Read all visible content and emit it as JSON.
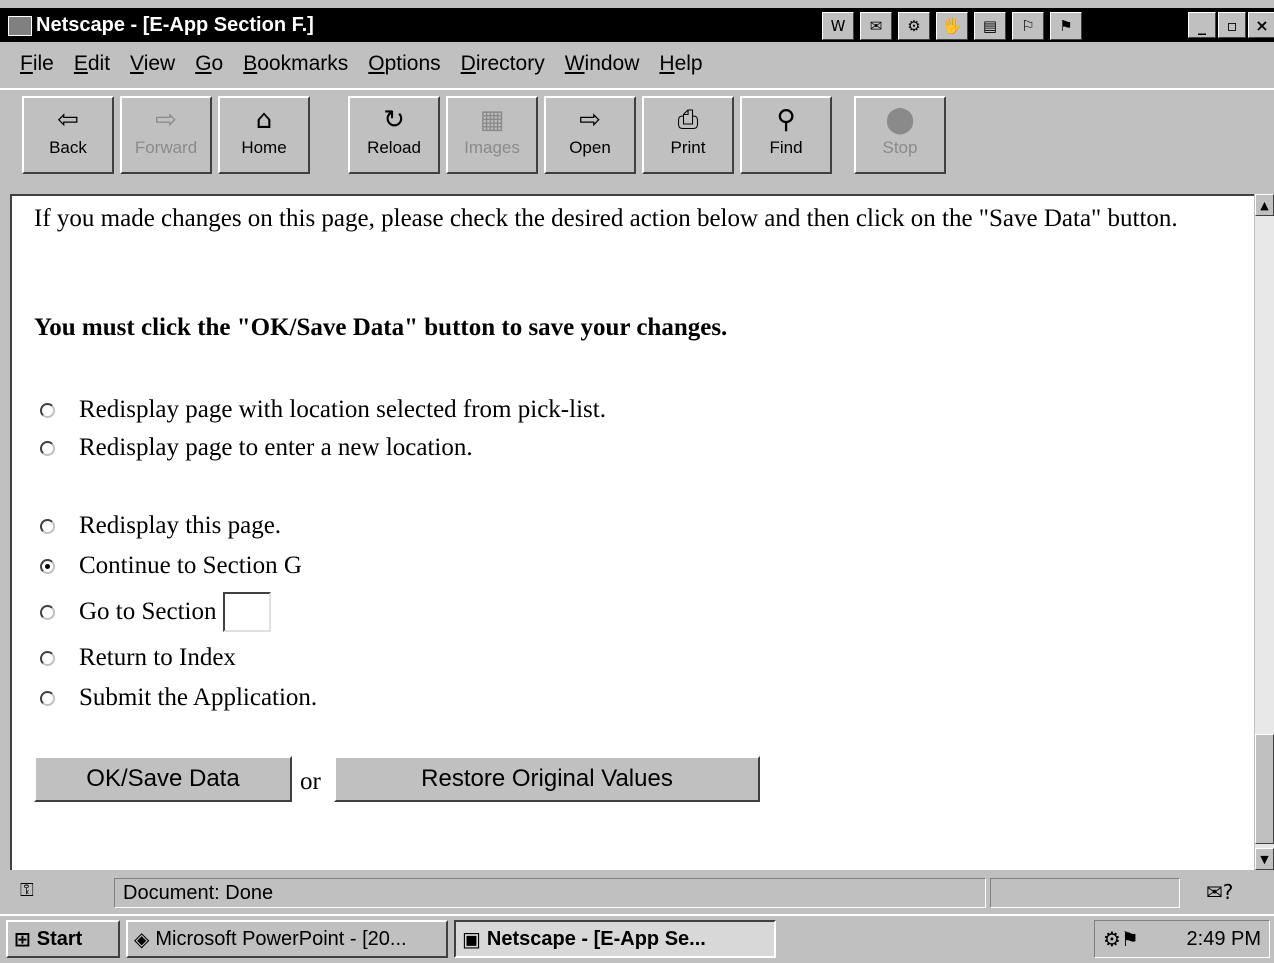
{
  "window": {
    "title": "Netscape - [E-App Section F.]",
    "app_icon": "netscape-icon",
    "title_icons": [
      "W",
      "✉",
      "⚙",
      "🖐",
      "▤",
      "⚐",
      "⚑"
    ],
    "minimize": "_",
    "maximize": "▫",
    "close": "×"
  },
  "menu": {
    "items": [
      {
        "mnemonic": "F",
        "rest": "ile"
      },
      {
        "mnemonic": "E",
        "rest": "dit"
      },
      {
        "mnemonic": "V",
        "rest": "iew"
      },
      {
        "mnemonic": "G",
        "rest": "o"
      },
      {
        "mnemonic": "B",
        "rest": "ookmarks"
      },
      {
        "mnemonic": "O",
        "rest": "ptions"
      },
      {
        "mnemonic": "D",
        "rest": "irectory"
      },
      {
        "mnemonic": "W",
        "rest": "indow"
      },
      {
        "mnemonic": "H",
        "rest": "elp"
      }
    ]
  },
  "toolbar": {
    "back": {
      "label": "Back",
      "icon": "⇦"
    },
    "forward": {
      "label": "Forward",
      "icon": "⇨"
    },
    "home": {
      "label": "Home",
      "icon": "⌂"
    },
    "reload": {
      "label": "Reload",
      "icon": "↻"
    },
    "images": {
      "label": "Images",
      "icon": "▦"
    },
    "open": {
      "label": "Open",
      "icon": "⇨"
    },
    "print": {
      "label": "Print",
      "icon": "⎙"
    },
    "find": {
      "label": "Find",
      "icon": "⚲"
    },
    "stop": {
      "label": "Stop",
      "icon": "⬤"
    }
  },
  "content": {
    "intro": "If you made changes on this page, please check the desired action below and then click on the \"Save Data\" button.",
    "must_click": "You must click the \"OK/Save Data\" button to save your changes.",
    "options": {
      "pick_list": "Redisplay page with location selected from pick-list.",
      "new_location": "Redisplay page to enter a new location.",
      "redisplay": "Redisplay this page.",
      "continue_g": "Continue to Section G",
      "goto_section": "Go to Section",
      "return_index": "Return to Index",
      "submit_app": "Submit the Application."
    },
    "selected_option": "continue_g",
    "goto_section_value": "",
    "ok_save_button": "OK/Save Data",
    "or_text": "or",
    "restore_button": "Restore Original Values"
  },
  "scrollbar": {
    "up": "▲",
    "down": "▼"
  },
  "status": {
    "text": "Document: Done",
    "security_icon": "⚿",
    "mail_icon": "✉?"
  },
  "taskbar": {
    "start": "Start",
    "start_icon": "⊞",
    "tasks": [
      {
        "icon": "◈",
        "label": "Microsoft PowerPoint - [20..."
      },
      {
        "icon": "▣",
        "label": "Netscape - [E-App Se..."
      }
    ],
    "tray_icons": "⚙⚑",
    "clock": "2:49 PM"
  }
}
